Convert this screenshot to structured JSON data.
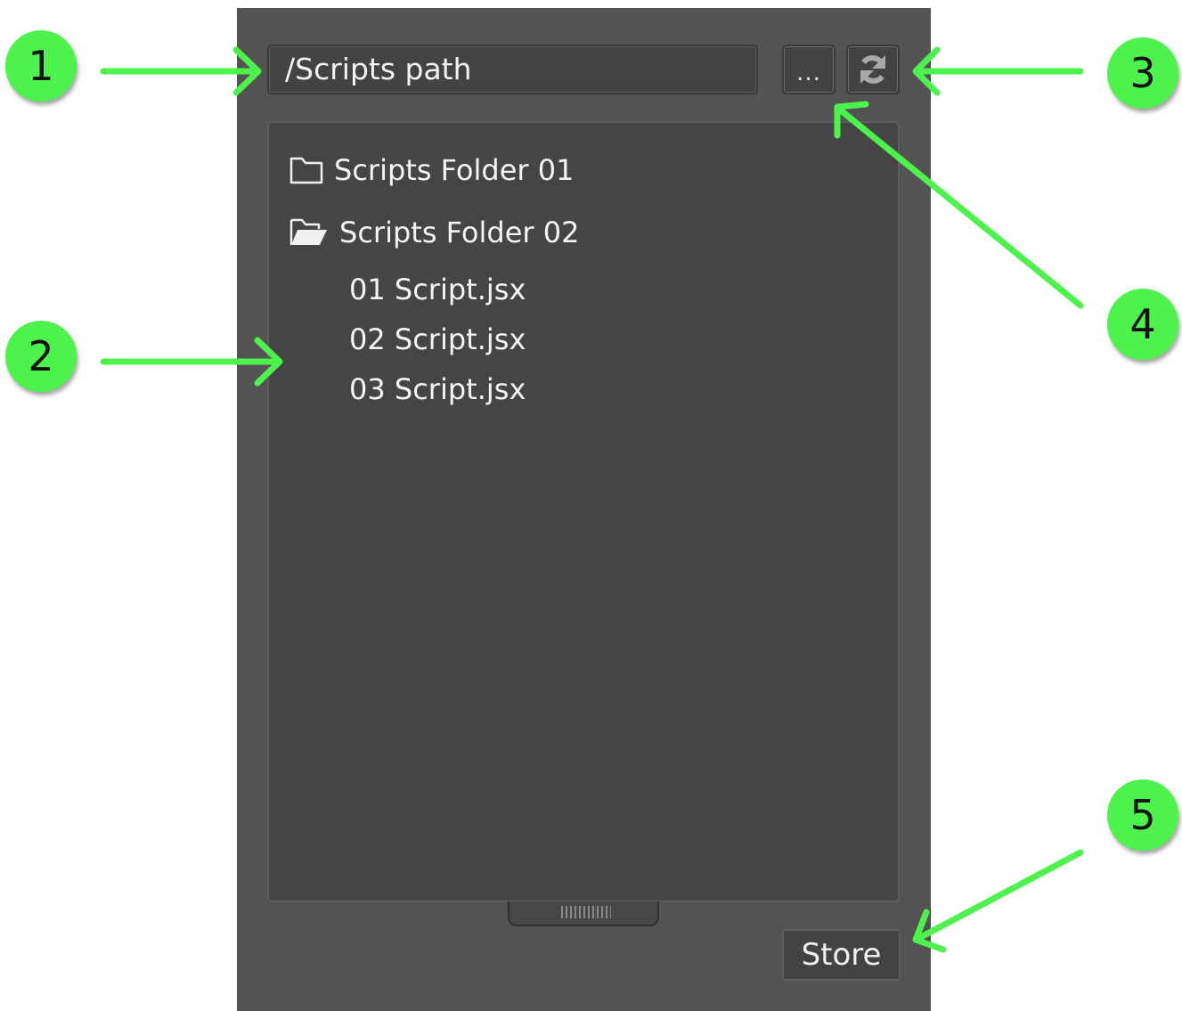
{
  "path_field": {
    "value": "/Scripts path"
  },
  "buttons": {
    "browse_label": "...",
    "refresh_icon": "refresh-icon",
    "store_label": "Store"
  },
  "tree": {
    "folders": [
      {
        "label": "Scripts Folder 01",
        "icon": "folder-closed-icon",
        "expanded": false
      },
      {
        "label": "Scripts Folder 02",
        "icon": "folder-open-icon",
        "expanded": true,
        "children": [
          "01 Script.jsx",
          "02 Script.jsx",
          "03 Script.jsx"
        ]
      }
    ]
  },
  "callouts": [
    "1",
    "2",
    "3",
    "4",
    "5"
  ],
  "colors": {
    "panel": "#535353",
    "field": "#434343",
    "accent_green": "#4df24d",
    "text": "#f4f4f4"
  }
}
